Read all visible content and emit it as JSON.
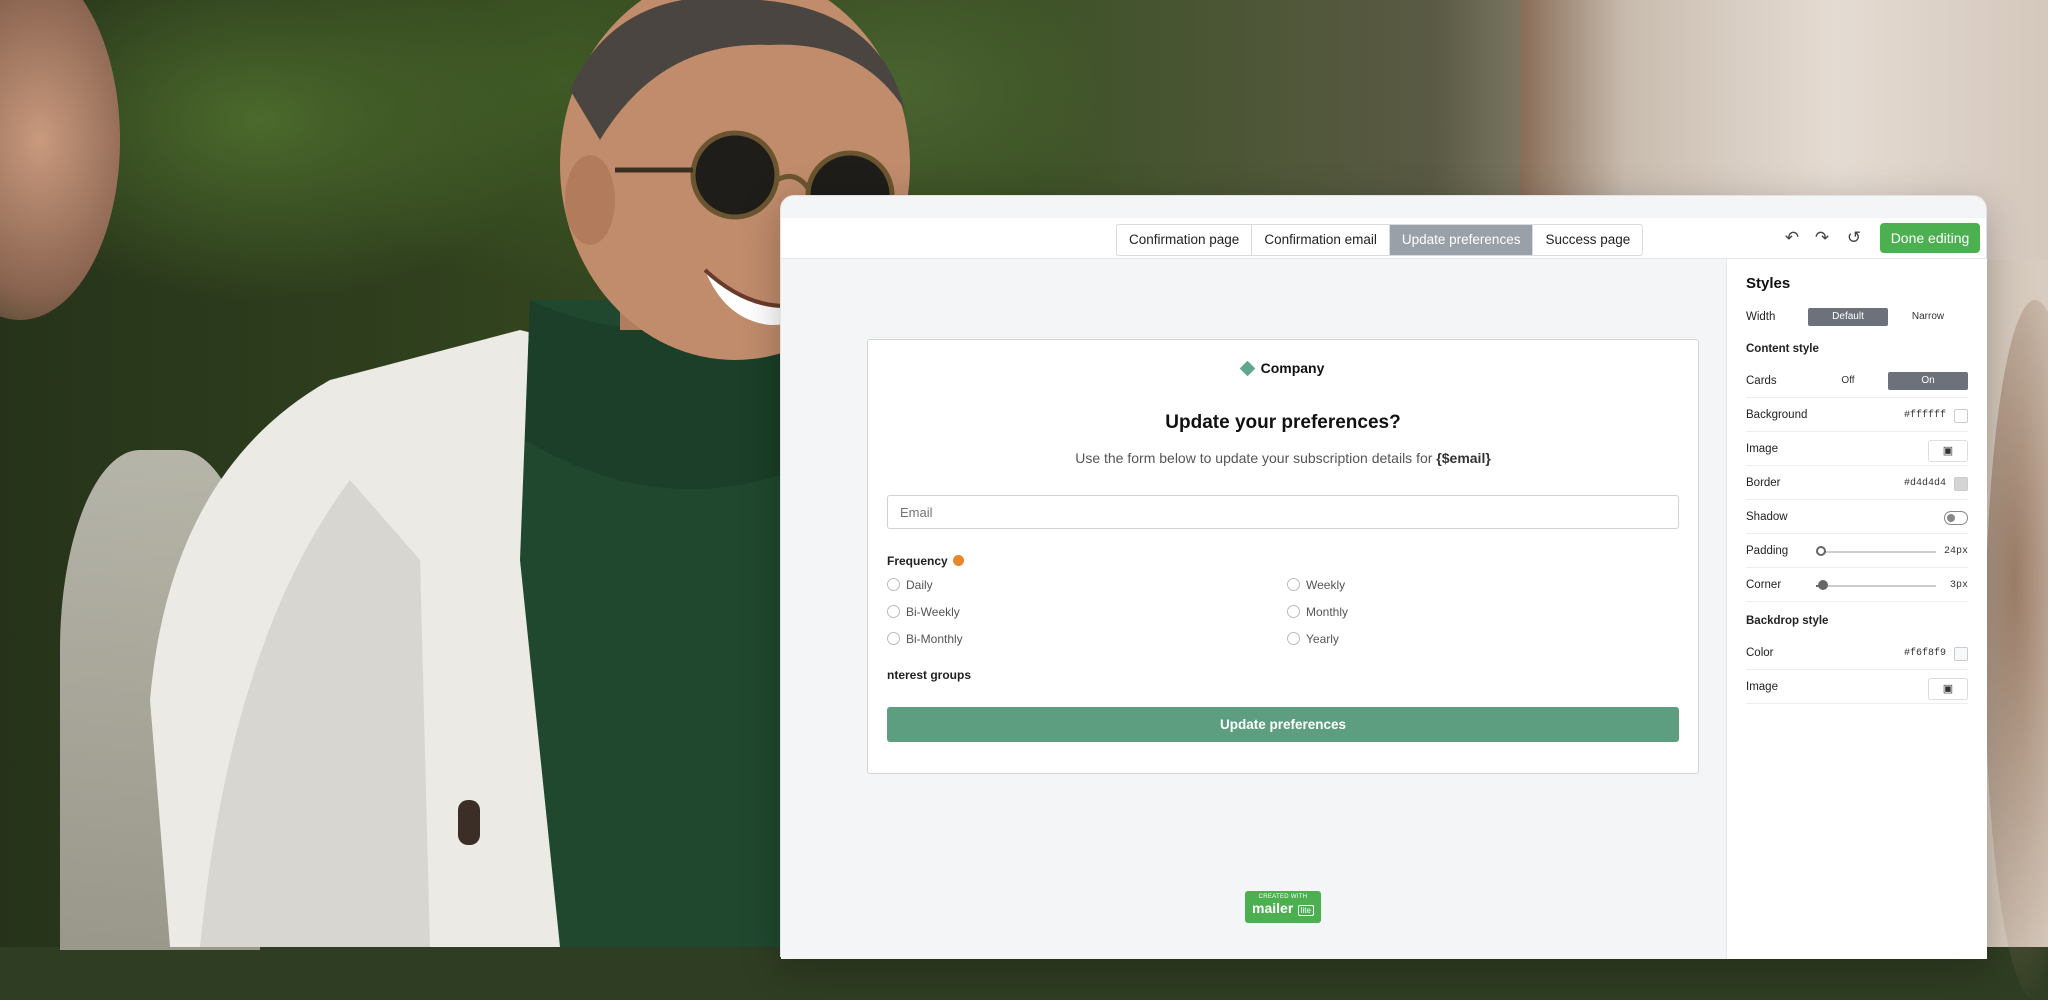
{
  "tabs": [
    "Confirmation page",
    "Confirmation email",
    "Update preferences",
    "Success page"
  ],
  "active_tab": "Update preferences",
  "toolbar": {
    "undo_icon": "undo-icon",
    "redo_icon": "redo-icon",
    "history_icon": "history-icon",
    "done_label": "Done editing",
    "done_color": "#4caf50"
  },
  "form": {
    "company": "Company",
    "title": "Update your preferences?",
    "subtitle_text": "Use the form below to update your subscription details for",
    "subtitle_var": "{$email}",
    "email_placeholder": "Email",
    "frequency_label": "Frequency",
    "frequency_options": [
      "Daily",
      "Weekly",
      "Bi-Weekly",
      "Monthly",
      "Bi-Monthly",
      "Yearly"
    ],
    "interest_label": "nterest groups",
    "submit_label": "Update preferences",
    "submit_color": "#5e9e80"
  },
  "badge": {
    "small": "CREATED WITH",
    "big": "mailer",
    "tag": "lite"
  },
  "styles_panel": {
    "title": "Styles",
    "width_label": "Width",
    "width_options": [
      "Default",
      "Narrow"
    ],
    "width_selected": "Default",
    "content_style_label": "Content style",
    "cards_label": "Cards",
    "cards_options": [
      "Off",
      "On"
    ],
    "cards_selected": "On",
    "background_label": "Background",
    "background_value": "#ffffff",
    "image_label": "Image",
    "border_label": "Border",
    "border_value": "#d4d4d4",
    "shadow_label": "Shadow",
    "padding_label": "Padding",
    "padding_value": "24px",
    "corner_label": "Corner",
    "corner_value": "3px",
    "backdrop_label": "Backdrop style",
    "color_label": "Color",
    "color_value": "#f6f8f9",
    "backdrop_image_label": "Image"
  }
}
